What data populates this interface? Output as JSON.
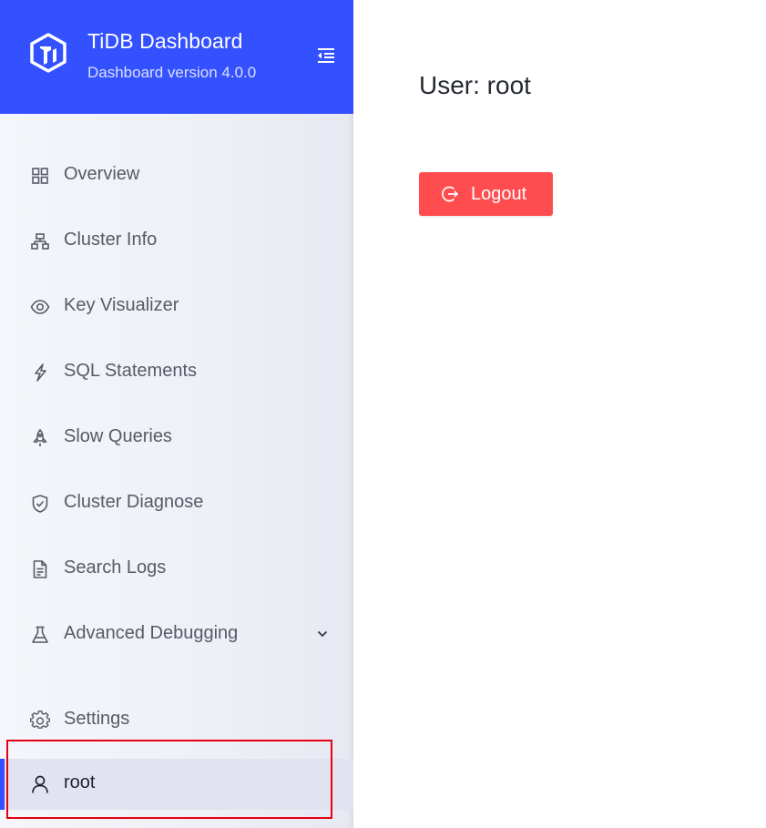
{
  "brand": {
    "title": "TiDB Dashboard",
    "version": "Dashboard version 4.0.0",
    "logo_icon": "tidb-logo-icon",
    "collapse_icon": "menu-fold-icon",
    "color": "#3351ff"
  },
  "sidebar": {
    "items": [
      {
        "label": "Overview",
        "icon": "appstore-icon"
      },
      {
        "label": "Cluster Info",
        "icon": "cluster-icon"
      },
      {
        "label": "Key Visualizer",
        "icon": "eye-icon"
      },
      {
        "label": "SQL Statements",
        "icon": "thunderbolt-icon"
      },
      {
        "label": "Slow Queries",
        "icon": "rocket-icon"
      },
      {
        "label": "Cluster Diagnose",
        "icon": "safety-check-icon"
      },
      {
        "label": "Search Logs",
        "icon": "file-text-icon"
      },
      {
        "label": "Advanced Debugging",
        "icon": "experiment-icon",
        "expandable": true,
        "arrow_icon": "chevron-down-icon"
      }
    ],
    "bottom_items": [
      {
        "label": "Settings",
        "icon": "gear-icon"
      },
      {
        "label": "root",
        "icon": "user-icon",
        "selected": true
      }
    ],
    "selected_color": "#3351ff"
  },
  "main": {
    "user_title": "User: root",
    "logout_label": "Logout",
    "logout_icon": "logout-icon",
    "logout_color": "#ff4d4f"
  }
}
